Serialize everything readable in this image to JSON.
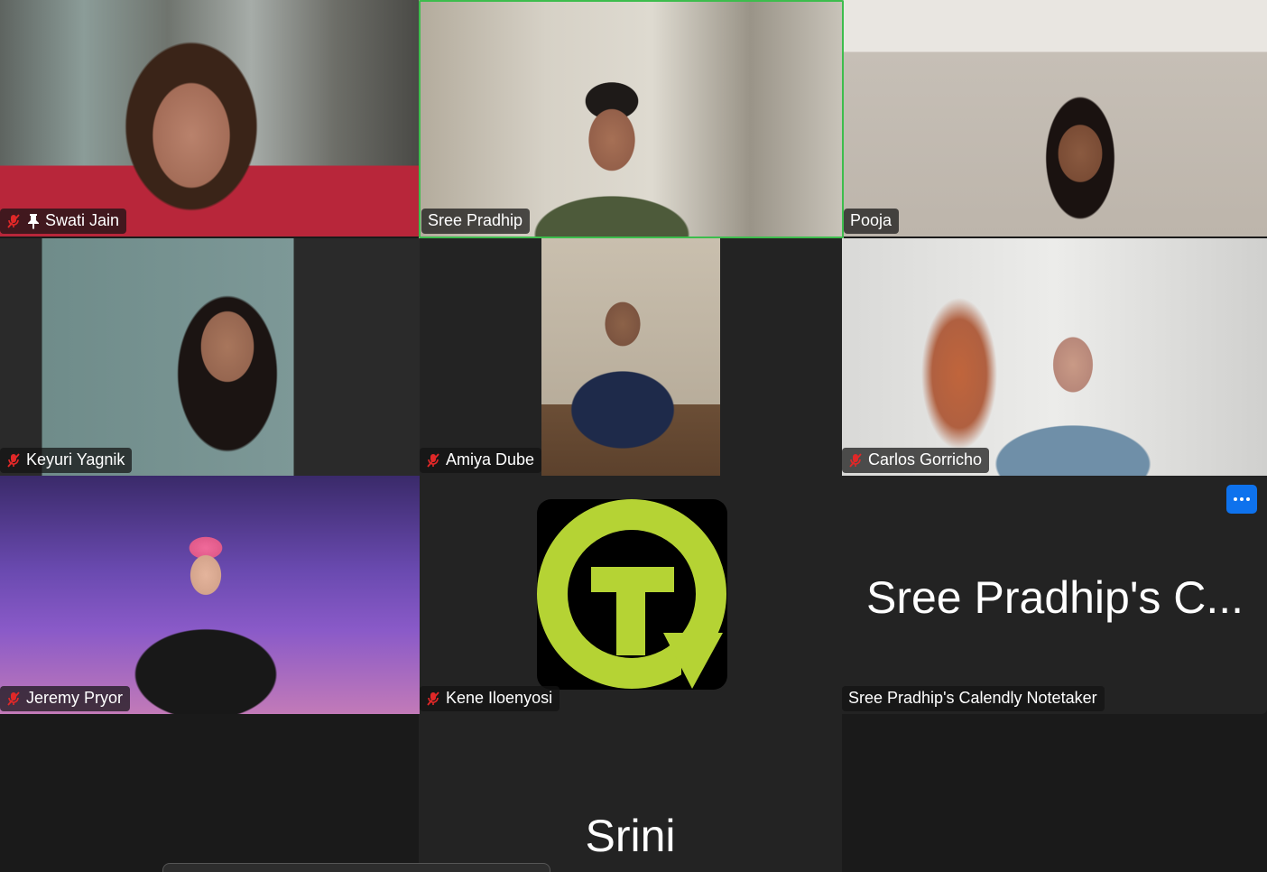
{
  "participants": {
    "swati": {
      "name": "Swati Jain",
      "muted": true,
      "pinned": true
    },
    "sree": {
      "name": "Sree Pradhip",
      "muted": false,
      "active_speaker": true
    },
    "pooja": {
      "name": "Pooja",
      "muted": false
    },
    "keyuri": {
      "name": "Keyuri Yagnik",
      "muted": true
    },
    "amiya": {
      "name": "Amiya Dube",
      "muted": true
    },
    "carlos": {
      "name": "Carlos Gorricho",
      "muted": true
    },
    "jeremy": {
      "name": "Jeremy Pryor",
      "muted": true
    },
    "kene": {
      "name": "Kene Iloenyosi",
      "muted": true
    },
    "notetaker": {
      "display_name": "Sree Pradhip's C...",
      "name": "Sree Pradhip's Calendly Notetaker",
      "muted": false
    },
    "srini": {
      "display_name": "Srini"
    }
  },
  "colors": {
    "active_speaker_border": "#3dbd4d",
    "muted_icon": "#e02828",
    "more_button": "#0e72ed",
    "logo_green": "#b5d334"
  },
  "icons": {
    "muted": "mic-muted-icon",
    "pin": "pin-icon",
    "more": "more-options-icon"
  }
}
